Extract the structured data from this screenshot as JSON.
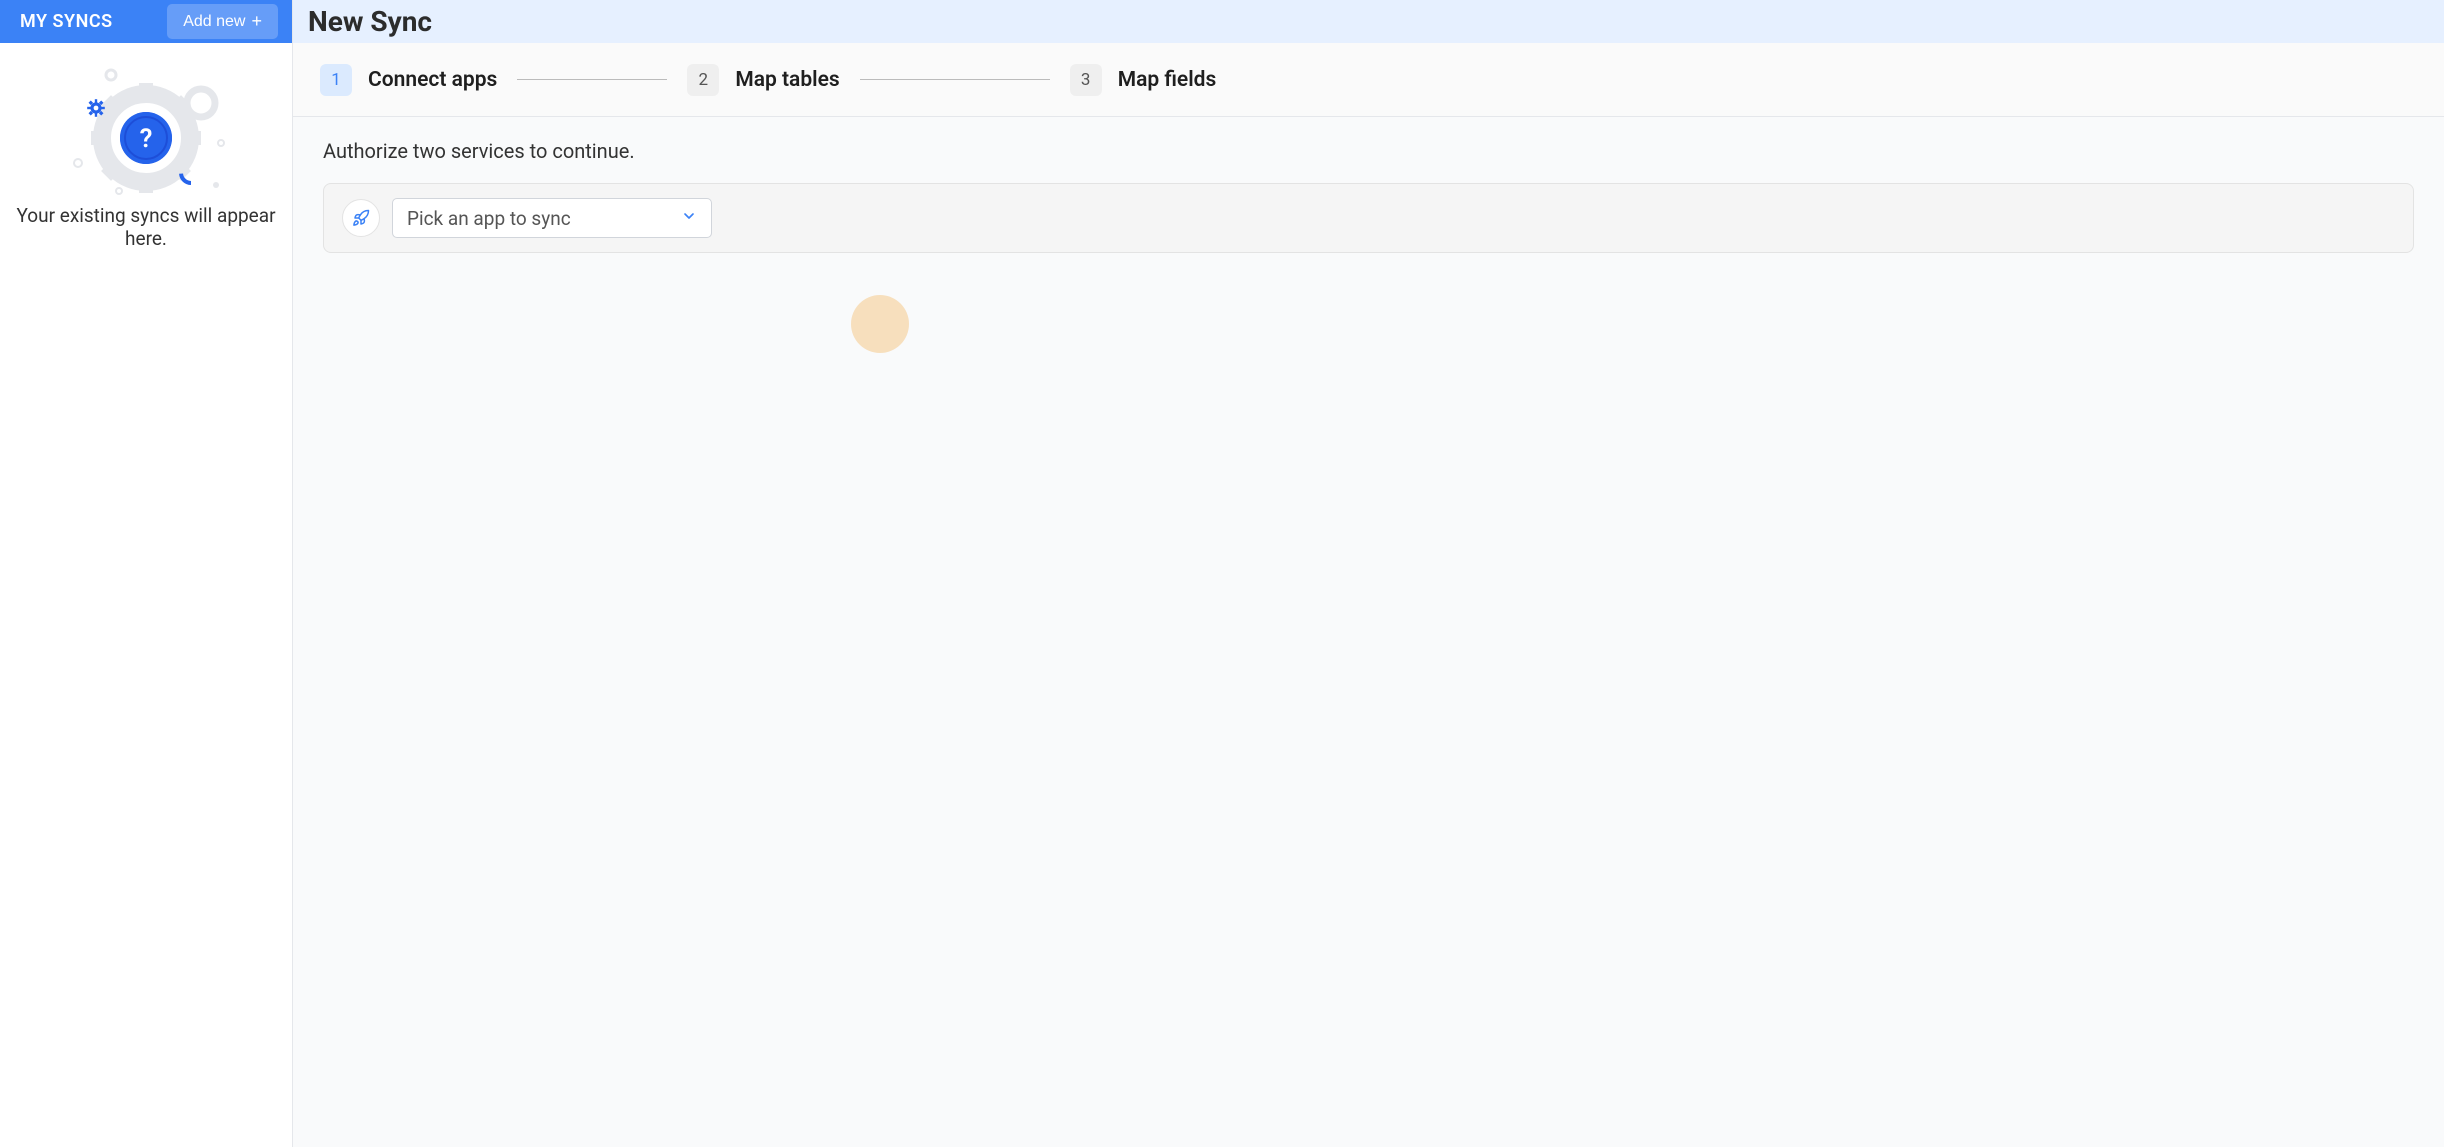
{
  "sidebar": {
    "title": "MY SYNCS",
    "add_button_label": "Add new",
    "empty_state_text": "Your existing syncs will appear here."
  },
  "header": {
    "title": "New Sync"
  },
  "stepper": {
    "steps": [
      {
        "number": "1",
        "label": "Connect apps",
        "active": true
      },
      {
        "number": "2",
        "label": "Map tables",
        "active": false
      },
      {
        "number": "3",
        "label": "Map fields",
        "active": false
      }
    ]
  },
  "content": {
    "instruction": "Authorize two services to continue.",
    "app_select_placeholder": "Pick an app to sync"
  }
}
